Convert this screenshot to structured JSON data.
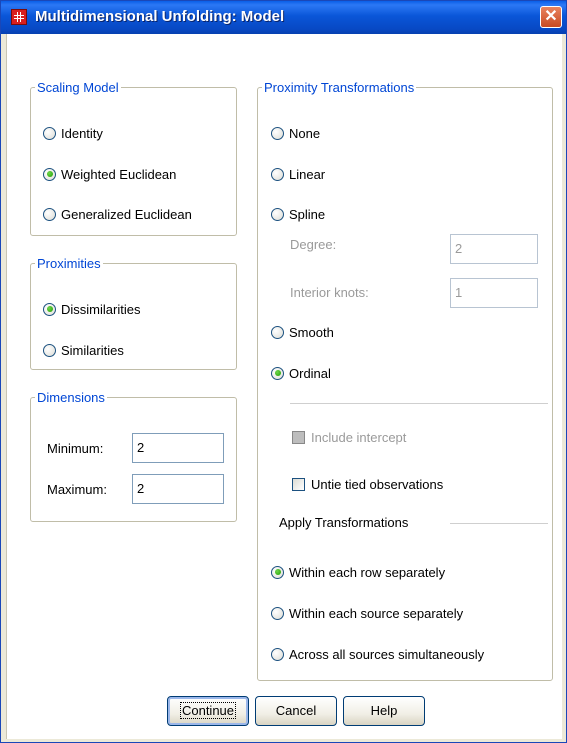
{
  "window": {
    "title": "Multidimensional Unfolding: Model",
    "close_glyph": "✕"
  },
  "scaling_model": {
    "legend": "Scaling Model",
    "options": [
      {
        "label": "Identity",
        "selected": false
      },
      {
        "label": "Weighted Euclidean",
        "selected": true
      },
      {
        "label": "Generalized Euclidean",
        "selected": false
      }
    ]
  },
  "proximities": {
    "legend": "Proximities",
    "options": [
      {
        "label": "Dissimilarities",
        "selected": true
      },
      {
        "label": "Similarities",
        "selected": false
      }
    ]
  },
  "dimensions": {
    "legend": "Dimensions",
    "minimum_label": "Minimum:",
    "minimum_value": "2",
    "maximum_label": "Maximum:",
    "maximum_value": "2"
  },
  "proximity_transformations": {
    "legend": "Proximity Transformations",
    "none_label": "None",
    "linear_label": "Linear",
    "spline_label": "Spline",
    "degree_label": "Degree:",
    "degree_value": "2",
    "interior_knots_label": "Interior knots:",
    "interior_knots_value": "1",
    "smooth_label": "Smooth",
    "ordinal_label": "Ordinal",
    "selected": "Ordinal",
    "include_intercept_label": "Include intercept",
    "include_intercept_enabled": false,
    "untie_label": "Untie tied observations",
    "untie_checked": false,
    "apply_header": "Apply Transformations",
    "apply_options": [
      {
        "label": "Within each row separately",
        "selected": true
      },
      {
        "label": "Within each source separately",
        "selected": false
      },
      {
        "label": "Across all sources simultaneously",
        "selected": false
      }
    ]
  },
  "buttons": {
    "continue": "Continue",
    "cancel": "Cancel",
    "help": "Help"
  },
  "colors": {
    "titlebar": "#0a56d8",
    "group_label": "#0046d5",
    "radio_selected": "#20a000",
    "disabled_text": "#9a9a9a"
  }
}
